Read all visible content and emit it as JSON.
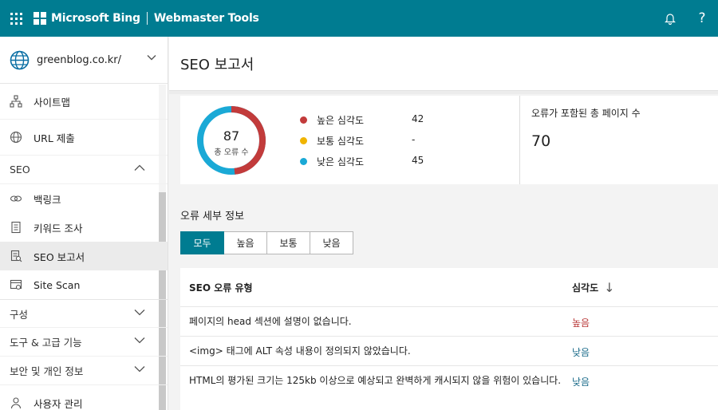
{
  "header": {
    "brand": "Microsoft Bing",
    "product": "Webmaster Tools",
    "icons": [
      "app-launcher-icon",
      "bell-icon",
      "help-icon"
    ],
    "help_glyph": "?",
    "accent_color": "#007c91"
  },
  "sidebar": {
    "site": "greenblog.co.kr/",
    "items_top": [
      {
        "label": "사이트맵",
        "icon": "sitemap-icon"
      },
      {
        "label": "URL 제출",
        "icon": "globe-icon"
      }
    ],
    "seo_section": {
      "label": "SEO",
      "items": [
        {
          "label": "백링크",
          "icon": "link-icon"
        },
        {
          "label": "키워드 조사",
          "icon": "document-icon"
        },
        {
          "label": "SEO 보고서",
          "icon": "report-icon",
          "active": true
        },
        {
          "label": "Site Scan",
          "icon": "scan-icon"
        }
      ]
    },
    "collapsed_sections": [
      "구성",
      "도구 & 고급 기능",
      "보안 및 개인 정보"
    ],
    "bottom_item": {
      "label": "사용자 관리",
      "icon": "user-icon"
    }
  },
  "main": {
    "page_title": "SEO 보고서",
    "summary": {
      "total": "87",
      "total_label": "총 오류 수",
      "legend": [
        {
          "label": "높은 심각도",
          "value": "42",
          "color": "#c23b3b"
        },
        {
          "label": "보통 심각도",
          "value": "-",
          "color": "#f0b400"
        },
        {
          "label": "낮은 심각도",
          "value": "45",
          "color": "#1aa9d6"
        }
      ],
      "donut_fractions": {
        "high": 42,
        "low": 45,
        "total": 87
      }
    },
    "pages_card": {
      "label": "오류가 포함된 총 페이지 수",
      "value": "70"
    },
    "details": {
      "title": "오류 세부 정보",
      "filters": [
        "모두",
        "높음",
        "보통",
        "낮음"
      ],
      "selected_filter": "모두",
      "columns": [
        "SEO 오류 유형",
        "심각도"
      ],
      "sort_glyph": "↓",
      "rows": [
        {
          "type": "페이지의 head 섹션에 설명이 없습니다.",
          "severity": "높음"
        },
        {
          "type": "<img> 태그에 ALT 속성 내용이 정의되지 않았습니다.",
          "severity": "낮음"
        },
        {
          "type": "HTML의 평가된 크기는 125kb 이상으로 예상되고 완벽하게 캐시되지 않을 위험이 있습니다.",
          "severity": "낮음"
        }
      ]
    }
  }
}
